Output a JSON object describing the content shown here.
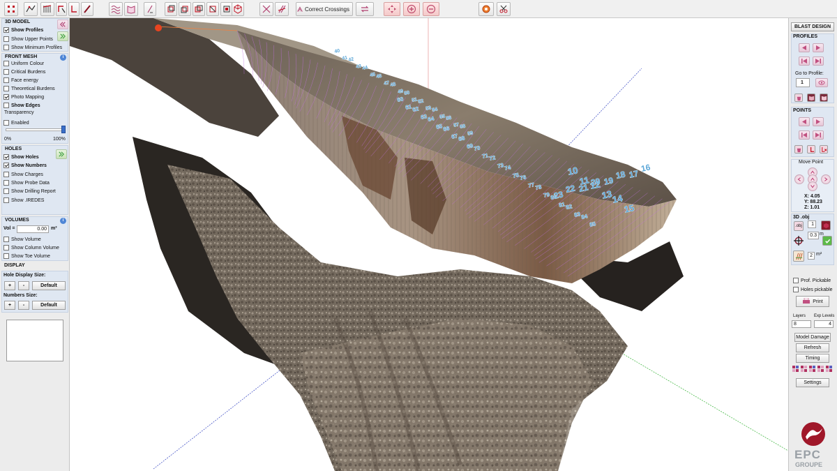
{
  "toolbar": {
    "correct_crossings_label": "Correct Crossings"
  },
  "left": {
    "model3d": {
      "header": "3D MODEL",
      "show_profiles": "Show Profiles",
      "show_upper_points": "Show Upper Points",
      "show_minimum_profiles": "Show Minimum Profiles"
    },
    "front_mesh": {
      "header": "FRONT MESH",
      "uniform_colour": "Uniform Colour",
      "critical_burdens": "Critical Burdens",
      "face_energy": "Face energy",
      "theoretical_burdens": "Theoretical Burdens",
      "photo_mapping": "Photo Mapping",
      "show_edges": "Show Edges",
      "transparency": "Transparency",
      "enabled": "Enabled",
      "slider_min": "0%",
      "slider_max": "100%",
      "transparency_level": 0.97
    },
    "holes": {
      "header": "HOLES",
      "show_holes": "Show Holes",
      "show_numbers": "Show Numbers",
      "show_charges": "Show Charges",
      "show_probe_data": "Show Probe Data",
      "show_drilling_report": "Show Drilling Report",
      "show_iredes": "Show .IREDES"
    },
    "volumes": {
      "header": "VOLUMES",
      "vol_label": "Vol =",
      "vol_value": "0.00",
      "vol_unit": "m³",
      "show_volume": "Show Volume",
      "show_column_volume": "Show Column Volume",
      "show_toe_volume": "Show Toe Volume"
    },
    "display": {
      "header": "DISPLAY",
      "hole_display_size": "Hole Display Size:",
      "numbers_size": "Numbers Size:",
      "plus": "+",
      "minus": "-",
      "default": "Default"
    }
  },
  "right": {
    "blast_design": "BLAST DESIGN",
    "profiles": "PROFILES",
    "go_to_profile": "Go to Profile:",
    "profile_value": "1",
    "points": "POINTS",
    "move_point": "Move Point",
    "x_coord": "X: 4.05",
    "y_coord": "Y: 88.23",
    "z_coord": "Z: 1.01",
    "obj_header": "3D .obj",
    "obj_label": ".obj",
    "obj_count": "1",
    "step_value": "0.3",
    "step_unit": "m",
    "area_value": "2",
    "area_unit": "m²",
    "prof_pickable": "Prof. Pickable",
    "holes_pickable": "Holes pickable",
    "print": "Print",
    "layers_label": "Layers",
    "exp_levels_label": "Exp Levels",
    "layers_value": "8",
    "exp_levels_value": "4",
    "model_damage": "Model Damage",
    "refresh": "Refresh",
    "timing": "Timing",
    "settings": "Settings",
    "logo_text": "EPC",
    "logo_sub": "GROUPE"
  },
  "viewport": {
    "hole_numbers": [
      {
        "n": "10"
      },
      {
        "n": "11"
      },
      {
        "n": "12"
      },
      {
        "n": "13"
      },
      {
        "n": "14"
      },
      {
        "n": "15"
      },
      {
        "n": "16"
      },
      {
        "n": "17"
      },
      {
        "n": "18"
      },
      {
        "n": "19"
      },
      {
        "n": "20"
      },
      {
        "n": "21"
      },
      {
        "n": "22"
      },
      {
        "n": "23"
      },
      {
        "n": "40"
      },
      {
        "n": "41"
      },
      {
        "n": "42"
      },
      {
        "n": "43"
      },
      {
        "n": "44"
      },
      {
        "n": "45"
      },
      {
        "n": "46"
      },
      {
        "n": "47"
      },
      {
        "n": "48"
      },
      {
        "n": "49"
      },
      {
        "n": "50"
      },
      {
        "n": "51"
      },
      {
        "n": "52"
      },
      {
        "n": "53"
      },
      {
        "n": "54"
      },
      {
        "n": "55"
      },
      {
        "n": "56"
      },
      {
        "n": "57"
      },
      {
        "n": "58"
      },
      {
        "n": "59"
      },
      {
        "n": "60"
      },
      {
        "n": "61"
      },
      {
        "n": "62"
      },
      {
        "n": "63"
      },
      {
        "n": "64"
      },
      {
        "n": "65"
      },
      {
        "n": "66"
      },
      {
        "n": "67"
      },
      {
        "n": "68"
      },
      {
        "n": "69"
      },
      {
        "n": "70"
      },
      {
        "n": "71"
      },
      {
        "n": "72"
      },
      {
        "n": "73"
      },
      {
        "n": "74"
      },
      {
        "n": "75"
      },
      {
        "n": "76"
      },
      {
        "n": "77"
      },
      {
        "n": "78"
      },
      {
        "n": "79"
      },
      {
        "n": "80"
      },
      {
        "n": "81"
      },
      {
        "n": "82"
      },
      {
        "n": "83"
      },
      {
        "n": "84"
      },
      {
        "n": "85"
      }
    ]
  },
  "colors": {
    "accent_blue": "#3b6fc8",
    "hole_label": "#5ea8d8",
    "profile_lines": "#c070e0",
    "axis_blue": "#3040c0",
    "axis_green": "#30b030",
    "logo_red": "#a0182a"
  }
}
